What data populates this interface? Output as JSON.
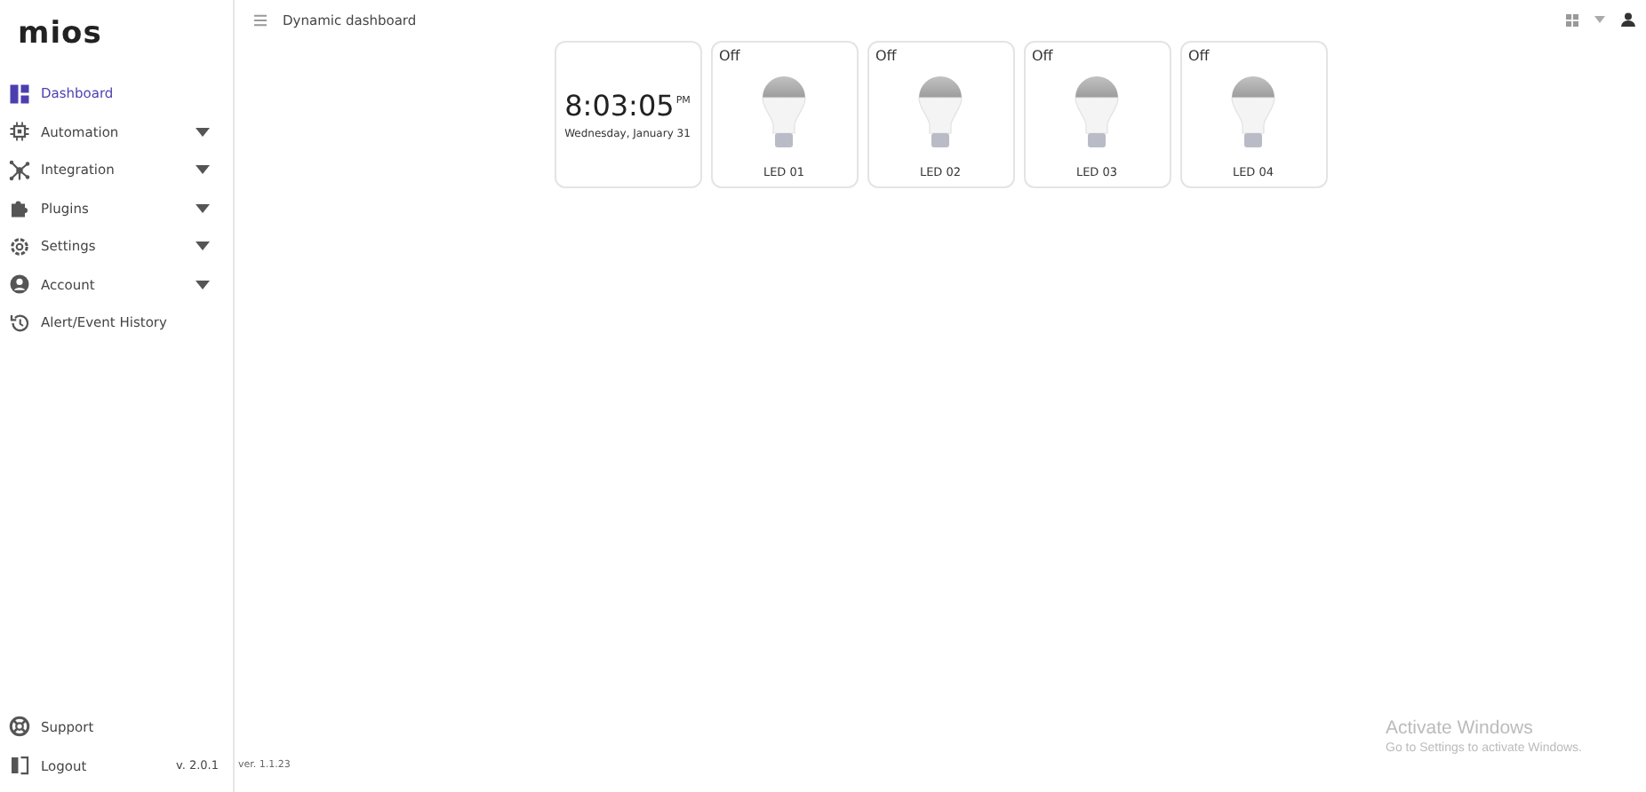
{
  "sidebar": {
    "logo": "mios",
    "items": [
      {
        "label": "Dashboard",
        "selected": true,
        "has_submenu": false
      },
      {
        "label": "Automation",
        "selected": false,
        "has_submenu": true
      },
      {
        "label": "Integration",
        "selected": false,
        "has_submenu": true
      },
      {
        "label": "Plugins",
        "selected": false,
        "has_submenu": true
      },
      {
        "label": "Settings",
        "selected": false,
        "has_submenu": true
      },
      {
        "label": "Account",
        "selected": false,
        "has_submenu": true
      },
      {
        "label": "Alert/Event History",
        "selected": false,
        "has_submenu": false
      }
    ],
    "footer": [
      {
        "label": "Support"
      },
      {
        "label": "Logout",
        "version": "v. 2.0.1"
      }
    ]
  },
  "header": {
    "title": "Dynamic dashboard"
  },
  "clock": {
    "time": "8:03:05",
    "period": "PM",
    "date": "Wednesday, January 31"
  },
  "lights": [
    {
      "status": "Off",
      "on": false,
      "name": "LED 01"
    },
    {
      "status": "Off",
      "on": false,
      "name": "LED 02"
    },
    {
      "status": "Off",
      "on": false,
      "name": "LED 03"
    },
    {
      "status": "Off",
      "on": false,
      "name": "LED 04"
    }
  ],
  "build": "ver. 1.1.23",
  "os_notice": {
    "title": "Activate Windows",
    "text": "Go to Settings to activate Windows."
  }
}
